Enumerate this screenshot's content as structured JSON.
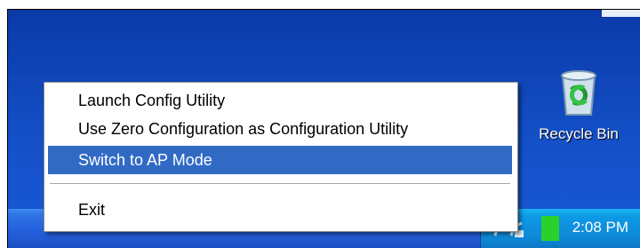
{
  "desktop": {
    "recycle_bin": {
      "label": "Recycle Bin",
      "icon": "recycle-bin-icon"
    }
  },
  "taskbar": {
    "clock": "2:08 PM",
    "tray_icons": [
      "network-icon",
      "wireless-utility-icon"
    ]
  },
  "context_menu": {
    "items": [
      {
        "label": "Launch Config Utility"
      },
      {
        "label": "Use Zero Configuration as Configuration Utility"
      },
      {
        "label": "Switch to AP Mode",
        "highlighted": true
      },
      {
        "label": "Exit"
      }
    ]
  },
  "colors": {
    "desktop": "#1450c8",
    "menu_highlight": "#316ac5",
    "tray": "#0f8ad8"
  }
}
